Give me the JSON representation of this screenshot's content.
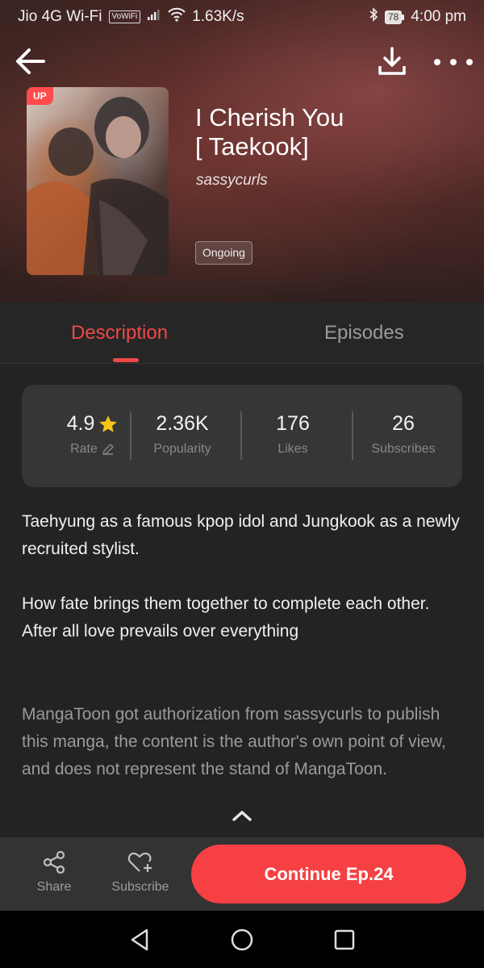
{
  "status_bar": {
    "carrier": "Jio 4G Wi-Fi",
    "vowifi": "VoWiFi",
    "speed": "1.63K/s",
    "battery": "78",
    "time": "4:00 pm"
  },
  "book": {
    "badge": "UP",
    "title_line1": "I Cherish You",
    "title_line2": "[ Taekook]",
    "author": "sassycurls",
    "status": "Ongoing"
  },
  "tabs": [
    {
      "label": "Description",
      "active": true
    },
    {
      "label": "Episodes",
      "active": false
    }
  ],
  "stats": [
    {
      "value": "4.9",
      "label": "Rate"
    },
    {
      "value": "2.36K",
      "label": "Popularity"
    },
    {
      "value": "176",
      "label": "Likes"
    },
    {
      "value": "26",
      "label": "Subscribes"
    }
  ],
  "description": {
    "p1": "Taehyung as a famous kpop idol and Jungkook as a newly recruited stylist.",
    "p2": "How fate brings them together to complete each other.",
    "p3": "After all love prevails over everything",
    "disclaimer": "MangaToon got authorization from sassycurls to publish this manga, the content is the author's own point of view, and does not represent the stand of MangaToon."
  },
  "bottom_bar": {
    "share_label": "Share",
    "subscribe_label": "Subscribe",
    "continue_label": "Continue Ep.24"
  },
  "colors": {
    "accent": "#f04848",
    "button": "#f64044",
    "star": "#f5c518"
  }
}
